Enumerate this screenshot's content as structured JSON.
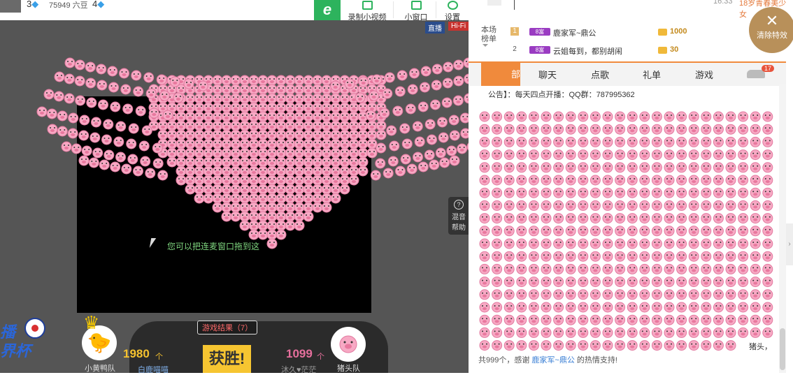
{
  "topbar": {
    "level_left": "3",
    "beans": "75949 六豆",
    "level_right": "4",
    "buttons": [
      {
        "label": "录制小视频",
        "icon": "record-icon"
      },
      {
        "label": "小窗口",
        "icon": "mini-window-icon"
      },
      {
        "label": "设置",
        "icon": "gear-icon"
      }
    ]
  },
  "video": {
    "badge_live": "直播",
    "badge_hifi": "Hi-Fi",
    "stage_hint": "您可以把连麦窗口拖到这",
    "mix_help": [
      "混音",
      "帮助"
    ],
    "mix_help_icon": "?"
  },
  "game": {
    "result": "游戏结果（7）",
    "team_left": {
      "name": "小黄鸭队",
      "score": "1980",
      "unit": "个",
      "user": "白鹿喵喵"
    },
    "team_right": {
      "name": "猪头队",
      "score": "1099",
      "unit": "个",
      "user": "沐久♥茫茫"
    },
    "win_label": "获胜!",
    "worldcup_logo": [
      "播",
      "界杯"
    ]
  },
  "right_panel": {
    "time": "16:33",
    "ticker": "18岁青春美少女",
    "rank_label": [
      "本场",
      "榜单"
    ],
    "rank": [
      {
        "n": "1",
        "level": "8富",
        "name": "鹿家军~鼎公",
        "value": "1000"
      },
      {
        "n": "2",
        "level": "8富",
        "name": "云姐每到，都别胡闹",
        "value": "30"
      }
    ],
    "clear_effects": "清除特效",
    "tabs": [
      "聊天",
      "点歌",
      "礼单",
      "游戏"
    ],
    "active_tab_fragment": "部",
    "car_count": "17",
    "notice": "公告】：每天四点开播：QQ群：787995362",
    "chat_tail": "猪头，",
    "footer": {
      "pre": "共999个，感谢",
      "name": "鹿家军~鼎公",
      "post": "的热情支持!"
    }
  },
  "colors": {
    "accent_orange": "#f08a3c",
    "brand_green": "#2db35d",
    "gold": "#f6c531",
    "pig_pink": "#f4a3bf"
  }
}
